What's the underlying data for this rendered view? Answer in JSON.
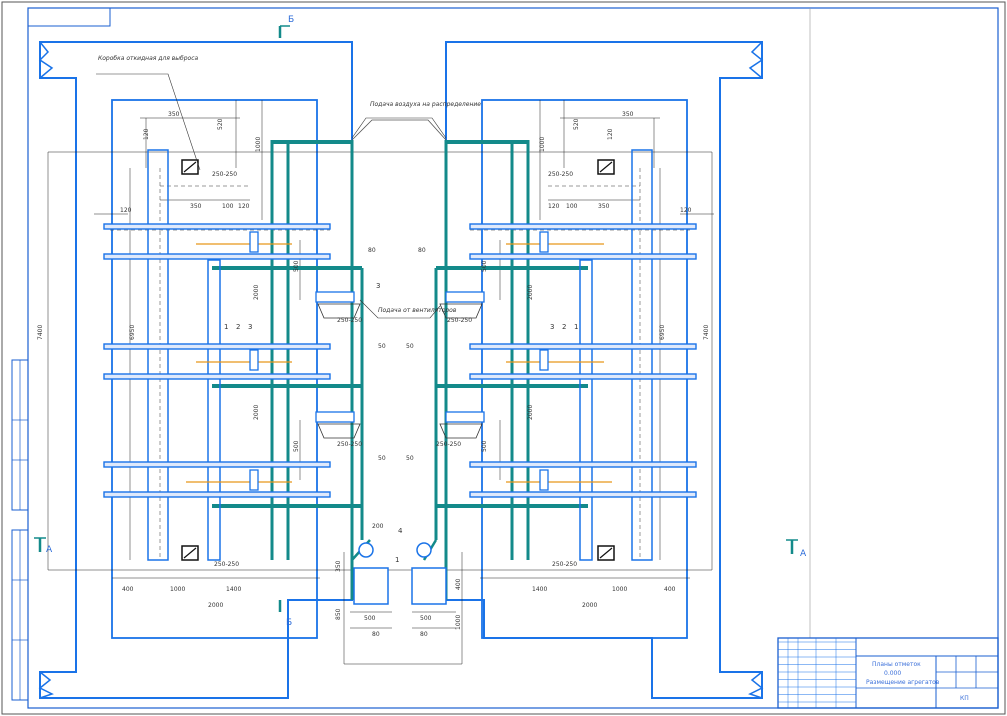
{
  "section_marks": {
    "b_top": "Б",
    "b_bottom": "Б",
    "a_left": "А",
    "a_right": "А"
  },
  "dimensions": {
    "d_250_250": "250-250",
    "d_350": "350",
    "d_120": "120",
    "d_520": "520",
    "d_100": "100",
    "d_400": "400",
    "d_1000": "1000",
    "d_1400": "1400",
    "d_2000": "2000",
    "d_500": "500",
    "d_850": "850",
    "d_80": "80",
    "d_50": "50",
    "d_200": "200",
    "d_6950": "6950",
    "d_7400": "7400"
  },
  "leader_notes": {
    "exhaust_box": "Коробка откидная для выброса",
    "supply_air": "Подача воздуха на распределение",
    "supply_from_fans": "Подача от вентиляторов"
  },
  "callouts": {
    "n1": "1",
    "n2": "2",
    "n3": "3",
    "n4": "4"
  },
  "title_block": {
    "title_line1": "Планы отметок",
    "title_line2": "0.000",
    "title_line3": "Размещение агрегатов",
    "sheet_code": "КП"
  },
  "colors": {
    "outline": "#1a73e8",
    "duct": "#138a8a",
    "orange": "#e8971a",
    "dim": "#222222"
  }
}
